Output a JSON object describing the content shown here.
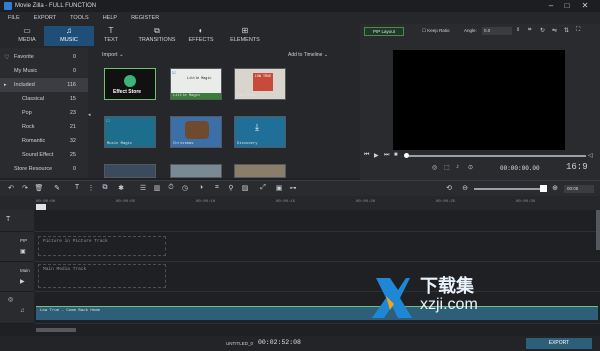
{
  "window": {
    "title": "Movie Zilla - FULL FUNCTION"
  },
  "menu": [
    "FILE",
    "EXPORT",
    "TOOLS",
    "HELP",
    "REGISTER"
  ],
  "tabs": [
    {
      "label": "MEDIA",
      "icon": "folder-icon"
    },
    {
      "label": "MUSIC",
      "icon": "music-note-icon"
    },
    {
      "label": "TEXT",
      "icon": "text-icon"
    },
    {
      "label": "TRANSITIONS",
      "icon": "transitions-icon"
    },
    {
      "label": "EFFECTS",
      "icon": "effects-icon"
    },
    {
      "label": "ELEMENTS",
      "icon": "elements-icon"
    }
  ],
  "active_tab": "MUSIC",
  "sidebar": [
    {
      "label": "Favorite",
      "count": "0"
    },
    {
      "label": "My Music",
      "count": "0"
    },
    {
      "label": "Included",
      "count": "116"
    },
    {
      "label": "Classical",
      "count": "15"
    },
    {
      "label": "Pop",
      "count": "23"
    },
    {
      "label": "Rock",
      "count": "21"
    },
    {
      "label": "Romantic",
      "count": "32"
    },
    {
      "label": "Sound Effect",
      "count": "25"
    },
    {
      "label": "Store Resource",
      "count": "0"
    }
  ],
  "library": {
    "import_label": "Import",
    "add_label": "Add to Timeline",
    "items": [
      {
        "caption": "Effect Store"
      },
      {
        "caption": "Little Magic"
      },
      {
        "caption": "Low True - C"
      },
      {
        "caption": "Music Magic"
      },
      {
        "caption": "Christmas"
      },
      {
        "caption": "Discovery"
      },
      {
        "caption": ""
      },
      {
        "caption": ""
      },
      {
        "caption": ""
      }
    ],
    "thumb_small_labels": {
      "little_magic": "Little Magic",
      "low_true": "LOW TRUE",
      "poster": "COUNT"
    }
  },
  "preview": {
    "pip_label": "PIP Layout",
    "keep_ratio": "Keep Ratio",
    "angle_label": "Angle:",
    "angle_value": "0.0",
    "timecode": "00:00:00.00",
    "ratio": "16:9"
  },
  "timeline": {
    "ticks": [
      "00:00:00",
      "00:00:05",
      "00:00:10",
      "00:00:15",
      "00:00:20",
      "00:00:25",
      "00:00:30",
      "00:00:35"
    ],
    "zoom_value": "00:05",
    "tracks": {
      "pip": {
        "label": "PIP",
        "placeholder": "Picture in Picture Track"
      },
      "main": {
        "label": "Main",
        "placeholder": "Main Media Track"
      },
      "audio_clip": "Low True - Come Back Home"
    }
  },
  "status": {
    "project_name": "UNTITLED_0",
    "time": "00:02:52:08",
    "export_label": "EXPORT"
  },
  "watermark": {
    "text_cn": "下载集",
    "domain": "xzji.com"
  }
}
